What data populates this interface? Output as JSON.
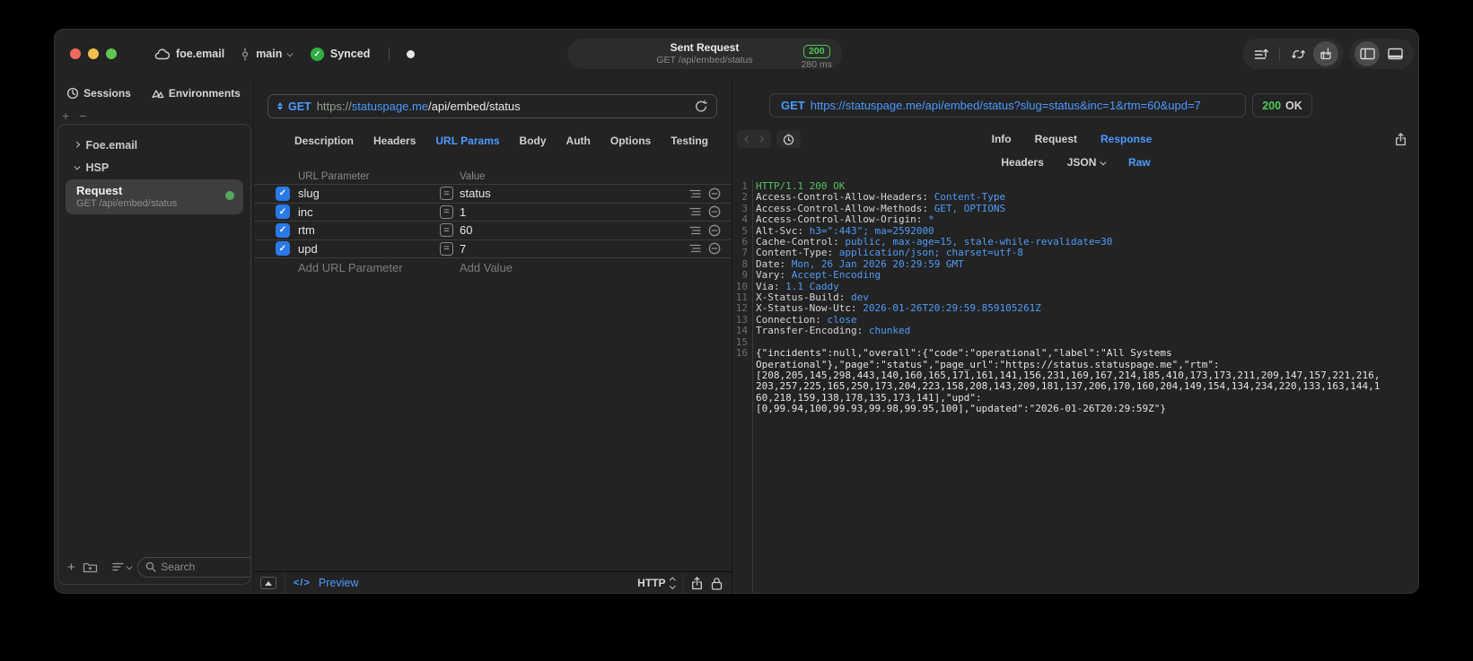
{
  "window": {
    "titlebar": {
      "project": "foe.email",
      "branch": "main",
      "sync_label": "Synced",
      "request_summary": {
        "title": "Sent Request",
        "subtitle": "GET /api/embed/status",
        "status_code": "200",
        "duration": "280 ms"
      }
    }
  },
  "sidebar": {
    "tabs": [
      {
        "label": "Sessions"
      },
      {
        "label": "Environments"
      }
    ],
    "tree": {
      "groups": [
        {
          "label": "Foe.email"
        },
        {
          "label": "HSP"
        }
      ],
      "selected_request": {
        "title": "Request",
        "subtitle": "GET /api/embed/status"
      }
    },
    "search_placeholder": "Search"
  },
  "request_editor": {
    "method": "GET",
    "url": {
      "scheme": "https://",
      "host": "statuspage.me",
      "path": "/api/embed/status"
    },
    "tabs": [
      "Description",
      "Headers",
      "URL Params",
      "Body",
      "Auth",
      "Options",
      "Testing"
    ],
    "active_tab": "URL Params",
    "params": {
      "columns": {
        "name": "URL Parameter",
        "value": "Value"
      },
      "eq_symbol": "=",
      "rows": [
        {
          "name": "slug",
          "value": "status",
          "checked": true
        },
        {
          "name": "inc",
          "value": "1",
          "checked": true
        },
        {
          "name": "rtm",
          "value": "60",
          "checked": true
        },
        {
          "name": "upd",
          "value": "7",
          "checked": true
        }
      ],
      "add_name_placeholder": "Add URL Parameter",
      "add_value_placeholder": "Add Value"
    },
    "footer": {
      "preview_icon": "</>",
      "preview": "Preview",
      "protocol": "HTTP"
    }
  },
  "response_viewer": {
    "request_line": {
      "method": "GET",
      "url": "https://statuspage.me/api/embed/status?slug=status&inc=1&rtm=60&upd=7"
    },
    "status": {
      "code": "200",
      "text": "OK"
    },
    "tabs": [
      "Info",
      "Request",
      "Response"
    ],
    "active_tab": "Response",
    "view_modes": [
      "Headers",
      "JSON",
      "Raw"
    ],
    "active_view_mode": "Raw",
    "raw": {
      "status_line": "HTTP/1.1 200 OK",
      "headers": [
        {
          "name": "Access-Control-Allow-Headers",
          "value": "Content-Type"
        },
        {
          "name": "Access-Control-Allow-Methods",
          "value": "GET, OPTIONS"
        },
        {
          "name": "Access-Control-Allow-Origin",
          "value": "*"
        },
        {
          "name": "Alt-Svc",
          "value": "h3=\":443\"; ma=2592000"
        },
        {
          "name": "Cache-Control",
          "value": "public, max-age=15, stale-while-revalidate=30"
        },
        {
          "name": "Content-Type",
          "value": "application/json; charset=utf-8"
        },
        {
          "name": "Date",
          "value": "Mon, 26 Jan 2026 20:29:59 GMT"
        },
        {
          "name": "Vary",
          "value": "Accept-Encoding"
        },
        {
          "name": "Via",
          "value": "1.1 Caddy"
        },
        {
          "name": "X-Status-Build",
          "value": "dev"
        },
        {
          "name": "X-Status-Now-Utc",
          "value": "2026-01-26T20:29:59.859105261Z"
        },
        {
          "name": "Connection",
          "value": "close"
        },
        {
          "name": "Transfer-Encoding",
          "value": "chunked"
        }
      ],
      "body": "{\"incidents\":null,\"overall\":{\"code\":\"operational\",\"label\":\"All Systems Operational\"},\"page\":\"status\",\"page_url\":\"https://status.statuspage.me\",\"rtm\":\n[208,205,145,298,443,140,160,165,171,161,141,156,231,169,167,214,185,410,173,173,211,209,147,157,221,216,203,257,225,165,250,173,204,223,158,208,143,209,181,137,206,170,160,204,149,154,134,234,220,133,163,144,160,218,159,138,178,135,173,141],\"upd\":\n[0,99.94,100,99.93,99.98,99.95,100],\"updated\":\"2026-01-26T20:29:59Z\"}"
    }
  },
  "colors": {
    "accent_blue": "#4b9aff",
    "success_green": "#4eca57",
    "checkbox_blue": "#2979e8",
    "traffic_red": "#ed6a5e",
    "traffic_yellow": "#f4bf4f",
    "traffic_green": "#61c554"
  }
}
